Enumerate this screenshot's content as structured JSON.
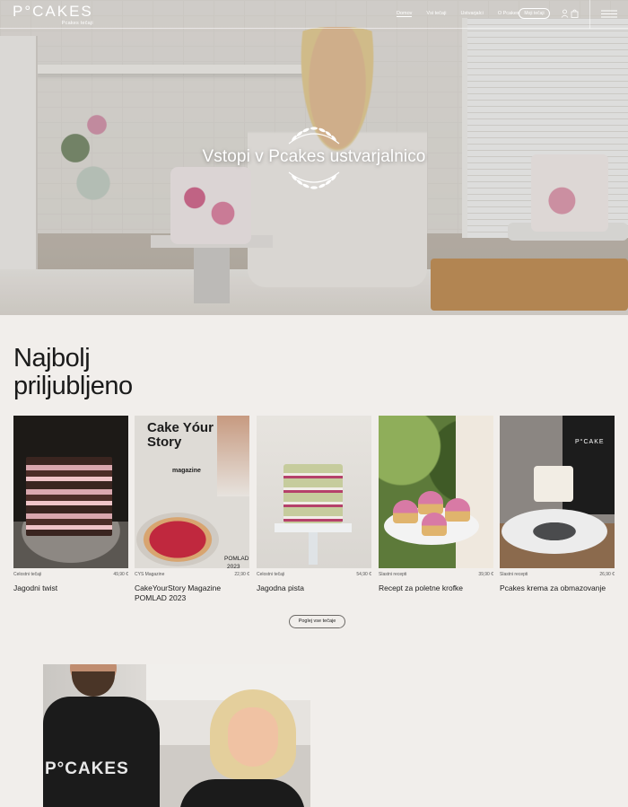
{
  "nav": {
    "logo": "P°CAKES",
    "logo_sub": "Pcakes tečaji",
    "links": [
      "Domov",
      "Vsi tečaji",
      "Ustvarjalci",
      "O Pcakes"
    ],
    "cta": "Moji tečaji",
    "icons": [
      "user-icon",
      "cart-icon",
      "menu-icon"
    ]
  },
  "hero": {
    "title": "Vstopi v Pcakes ustvarjalnico"
  },
  "section": {
    "title_line1": "Najbolj",
    "title_line2": "priljubljeno"
  },
  "products": [
    {
      "category": "Celostni tečaji",
      "price": "49,90 €",
      "name": "Jagodni twist"
    },
    {
      "category": "CYS Magazine",
      "price": "22,90 €",
      "name": "CakeYourStory Magazine POMLAD 2023",
      "cover_title": "Cake Yóur Story",
      "cover_sub": "magazine",
      "cover_season": "POMLAD",
      "cover_year": "2023"
    },
    {
      "category": "Celostni tečaji",
      "price": "54,90 €",
      "name": "Jagodna pista"
    },
    {
      "category": "Slastni recepti",
      "price": "39,90 €",
      "name": "Recept za poletne krofke"
    },
    {
      "category": "Slastni recepti",
      "price": "26,90 €",
      "name": "Pcakes krema za obmazovanje",
      "apron_text": "P°CAKE"
    }
  ],
  "cta": {
    "label": "Poglej vse tečaje"
  },
  "team": {
    "shirt_text": "P°CAKES"
  },
  "colors": {
    "background": "#f1eeeb",
    "text": "#1c1c1c",
    "nav_text": "#ffffff"
  }
}
